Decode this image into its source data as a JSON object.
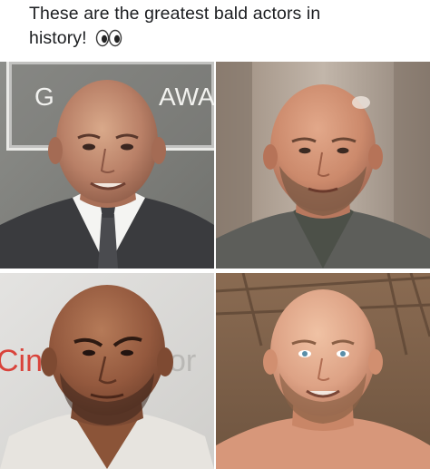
{
  "post": {
    "caption_line1": "These are the greatest bald actors in",
    "caption_line2": "history!",
    "emoji": "eyes-emoji"
  },
  "photos": [
    {
      "position": "top-left",
      "background_text": "G",
      "background_text_2": "AWA"
    },
    {
      "position": "top-right"
    },
    {
      "position": "bottom-left",
      "background_text": "Cin",
      "background_text_2": "or"
    },
    {
      "position": "bottom-right"
    }
  ]
}
